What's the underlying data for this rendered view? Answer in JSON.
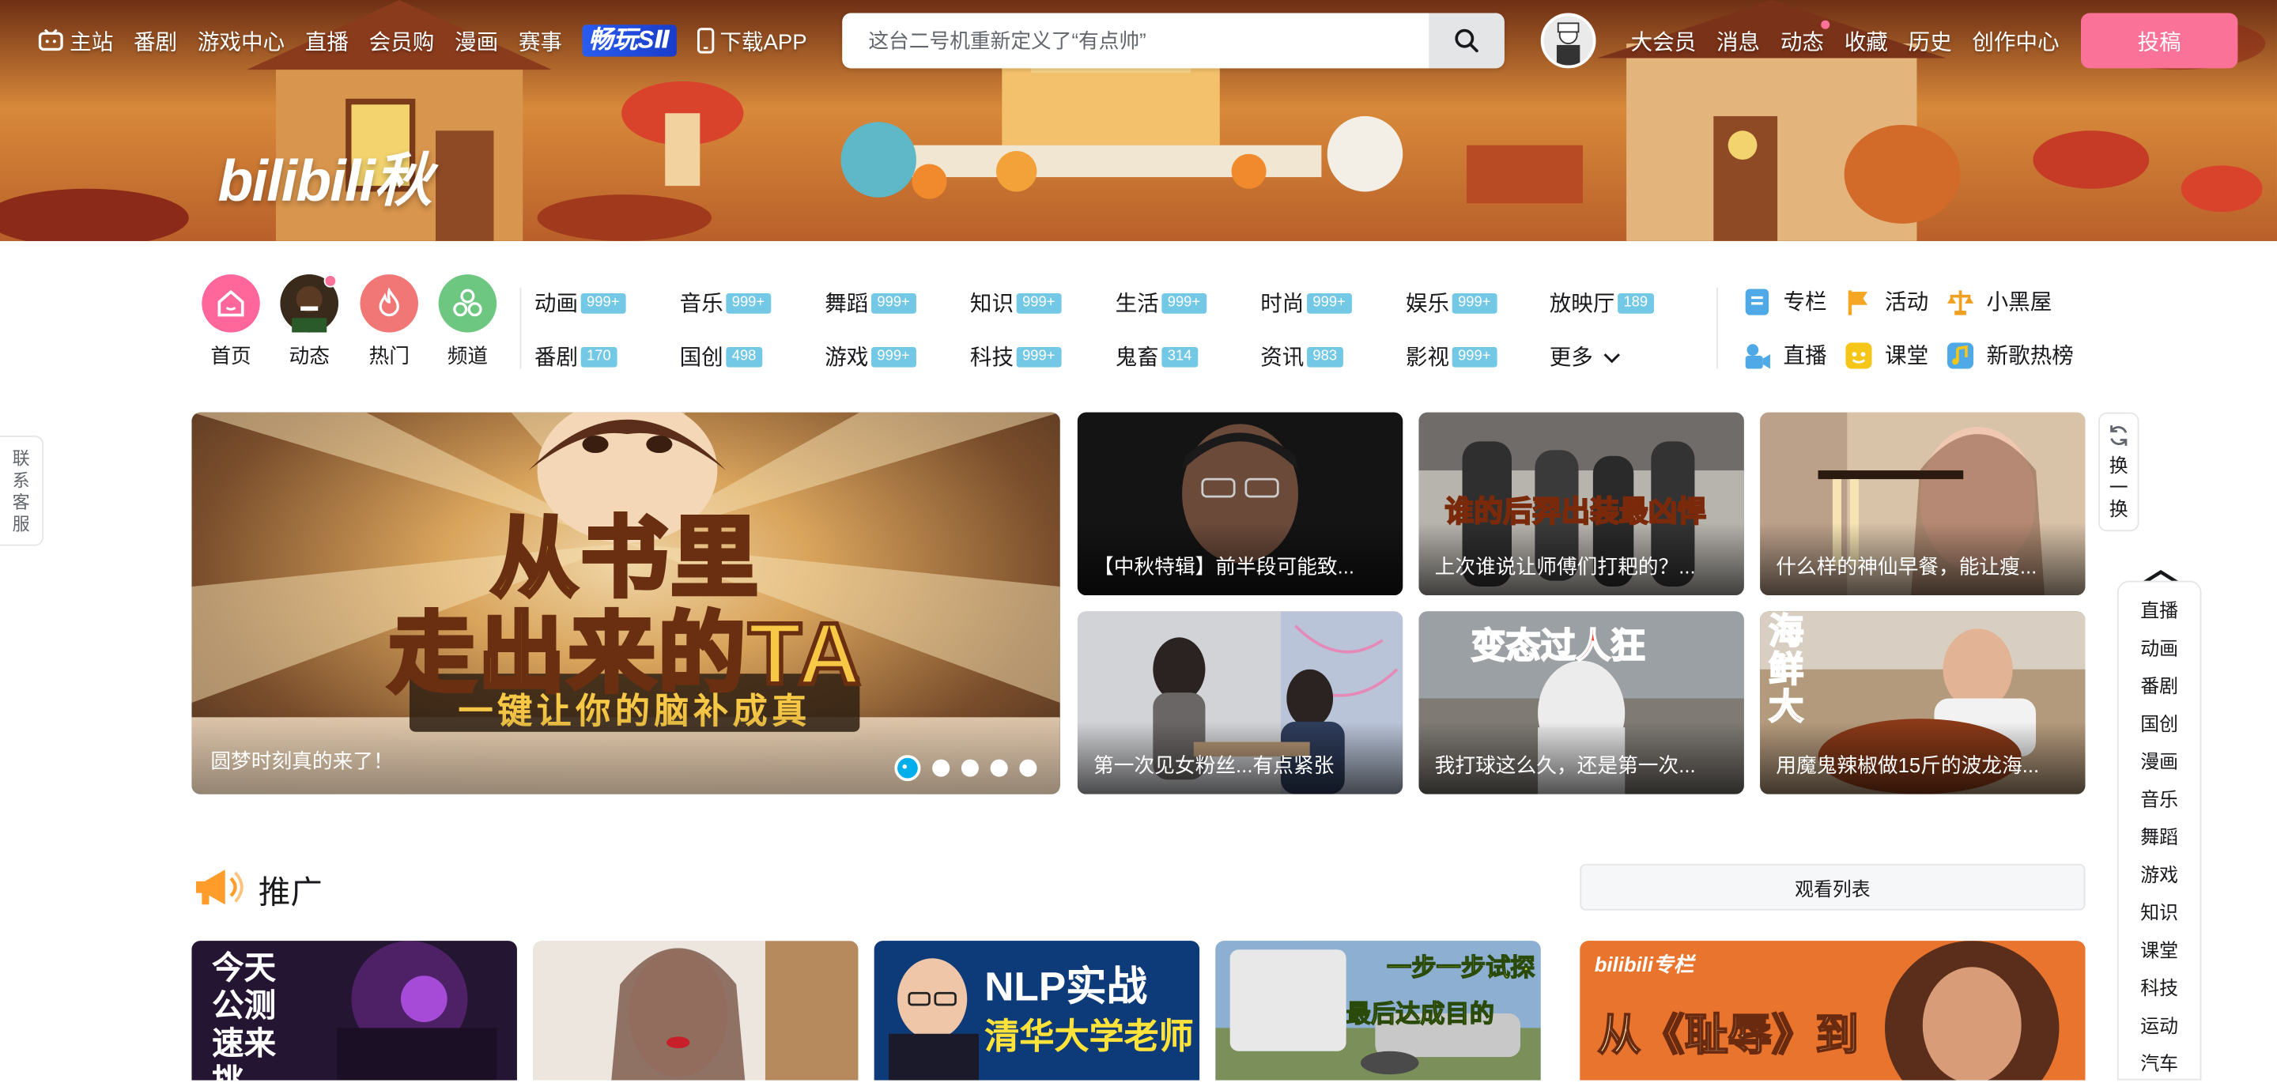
{
  "topnav": {
    "left_items": [
      "主站",
      "番剧",
      "游戏中心",
      "直播",
      "会员购",
      "漫画",
      "赛事"
    ],
    "changwan": "畅玩SⅡ",
    "download": "下载APP",
    "right_items": [
      "大会员",
      "消息",
      "动态",
      "收藏",
      "历史",
      "创作中心"
    ],
    "upload": "投稿"
  },
  "search": {
    "placeholder": "这台二号机重新定义了“有点帅”"
  },
  "logo": {
    "text": "bilibili秋"
  },
  "quick_entries": [
    "首页",
    "动态",
    "热门",
    "频道"
  ],
  "categories": [
    {
      "label": "动画",
      "badge": "999+"
    },
    {
      "label": "音乐",
      "badge": "999+"
    },
    {
      "label": "舞蹈",
      "badge": "999+"
    },
    {
      "label": "知识",
      "badge": "999+"
    },
    {
      "label": "生活",
      "badge": "999+"
    },
    {
      "label": "时尚",
      "badge": "999+"
    },
    {
      "label": "娱乐",
      "badge": "999+"
    },
    {
      "label": "放映厅",
      "badge": "189"
    },
    {
      "label": "番剧",
      "badge": "170"
    },
    {
      "label": "国创",
      "badge": "498"
    },
    {
      "label": "游戏",
      "badge": "999+"
    },
    {
      "label": "科技",
      "badge": "999+"
    },
    {
      "label": "鬼畜",
      "badge": "314"
    },
    {
      "label": "资讯",
      "badge": "983"
    },
    {
      "label": "影视",
      "badge": "999+"
    }
  ],
  "more_label": "更多",
  "ext_links": [
    "专栏",
    "活动",
    "小黑屋",
    "直播",
    "课堂",
    "新歌热榜"
  ],
  "carousel": {
    "caption": "圆梦时刻真的来了！",
    "headline_line1": "从书里",
    "headline_line2": "走出来的TA",
    "ribbon": "一键让你的脑补成真"
  },
  "videos": [
    {
      "title": "【中秋特辑】前半段可能致..."
    },
    {
      "title": "上次谁说让师傅们打耙的？..."
    },
    {
      "title": "什么样的神仙早餐，能让瘦..."
    },
    {
      "title": "第一次见女粉丝...有点紧张"
    },
    {
      "title": "我打球这么久，还是第一次..."
    },
    {
      "title": "用魔鬼辣椒做15斤的波龙海..."
    }
  ],
  "video_overlays": {
    "v2": "谁的后羿出装最凶悍",
    "v5": "变态过人狂",
    "v6": "海鲜大"
  },
  "refresh": {
    "label": "换一换"
  },
  "contact": {
    "label": "联系客服"
  },
  "side_nav": [
    "直播",
    "动画",
    "番剧",
    "国创",
    "漫画",
    "音乐",
    "舞蹈",
    "游戏",
    "知识",
    "课堂",
    "科技",
    "运动",
    "汽车"
  ],
  "promo": {
    "title": "推广",
    "watchlist": "观看列表",
    "card1_text": "今天公测 速来挑",
    "card3_line1": "NLP实战",
    "card3_line2": "清华大学老师",
    "card4_line1": "一步一步试探",
    "card4_line2": "最后达成目的",
    "card5_brand": "bilibili专栏",
    "card5_text": "从《耻辱》到"
  },
  "colors": {
    "accent": "#fb7299",
    "badge": "#73c9e5"
  }
}
